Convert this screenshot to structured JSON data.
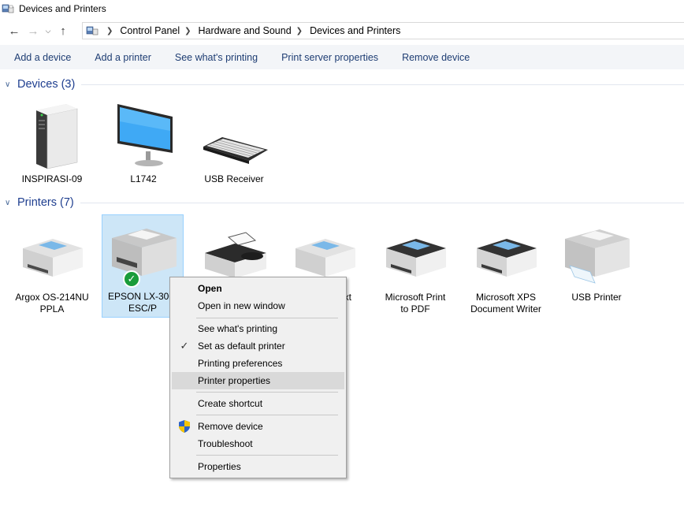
{
  "window": {
    "title": "Devices and Printers"
  },
  "nav": {
    "back_icon": "back-arrow-icon",
    "forward_icon": "forward-arrow-icon",
    "recent_icon": "chevron-down-icon",
    "up_icon": "up-arrow-icon"
  },
  "address": {
    "breadcrumbs": [
      "Control Panel",
      "Hardware and Sound",
      "Devices and Printers"
    ]
  },
  "commands": [
    "Add a device",
    "Add a printer",
    "See what's printing",
    "Print server properties",
    "Remove device"
  ],
  "devices": {
    "title": "Devices (3)",
    "items": [
      {
        "label": "INSPIRASI-09",
        "icon": "computer-tower-icon"
      },
      {
        "label": "L1742",
        "icon": "monitor-icon"
      },
      {
        "label": "USB Receiver",
        "icon": "keyboard-icon"
      }
    ]
  },
  "printers": {
    "title": "Printers (7)",
    "items": [
      {
        "label_line1": "Argox OS-214NU",
        "label_line2": "PPLA",
        "icon": "printer-icon"
      },
      {
        "label_line1": "EPSON LX-300-",
        "label_line2": "ESC/P",
        "icon": "printer-icon",
        "default": true
      },
      {
        "label_line1": "",
        "label_line2": "",
        "icon": "fax-icon"
      },
      {
        "label_line1": "xt",
        "label_line2": "",
        "icon": "printer-icon"
      },
      {
        "label_line1": "Microsoft Print",
        "label_line2": "to PDF",
        "icon": "printer-dark-icon"
      },
      {
        "label_line1": "Microsoft XPS",
        "label_line2": "Document Writer",
        "icon": "printer-dark-icon"
      },
      {
        "label_line1": "USB Printer",
        "label_line2": "",
        "icon": "printer-icon"
      }
    ]
  },
  "context_menu": {
    "open": "Open",
    "open_new_window": "Open in new window",
    "see_printing": "See what's printing",
    "set_default": "Set as default printer",
    "printing_prefs": "Printing preferences",
    "printer_props": "Printer properties",
    "create_shortcut": "Create shortcut",
    "remove_device": "Remove device",
    "troubleshoot": "Troubleshoot",
    "properties": "Properties"
  },
  "colors": {
    "accent": "#1e3e8f",
    "selection": "#cde6f7",
    "menu_hover": "#d9d9d9",
    "default_check": "#1a9c3a"
  }
}
